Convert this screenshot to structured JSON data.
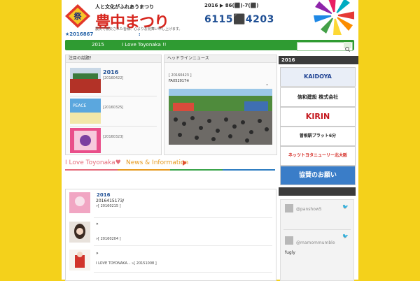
{
  "header": {
    "logo_subtitle": "人と文化がふれあうまつり",
    "logo_title": "豊中まつり",
    "logo_caption": "震災で被災された皆様、心よりお見舞い申し上げます。",
    "dates_line": "2016 ▶ 86(⬛)-7(⬛)",
    "dates_big": "6115⬛4203"
  },
  "notice": {
    "date_text": "★2016867",
    "colon": ":"
  },
  "nav": {
    "year": "2015",
    "love": "I Love Toyonaka !!",
    "search_placeholder": ""
  },
  "topics": {
    "head": "注目の話題！",
    "items": [
      {
        "year": "2016",
        "date": "[20160422]"
      },
      {
        "year": "",
        "date": "[20160325]"
      },
      {
        "year": "",
        "date": "[20160323]"
      }
    ]
  },
  "headline": {
    "head": "ヘッドラインニュース",
    "date": "[ 20160423 ]",
    "fax": "FAX52017※",
    "dot": "•"
  },
  "banner": {
    "love": "I Love Toyonaka♥",
    "news": "News & Information"
  },
  "posts": [
    {
      "year": "2016",
      "text": "2016415173/",
      "date": "»[ 20160215 ]"
    },
    {
      "year": "",
      "text": "»",
      "date": "»[ 20160204 ]"
    },
    {
      "year": "",
      "text": "»",
      "date": "I LOVE TOYONAKA... »[ 20151008 ]"
    }
  ],
  "sidebar": {
    "head": "2016",
    "ads": [
      {
        "label": "KAIDOYA",
        "color": "#1b3f91",
        "bg": "#e9eef7"
      },
      {
        "label": "信和建設 株式会社",
        "color": "#202020",
        "bg": "#ffffff"
      },
      {
        "label": "KIRIN",
        "color": "#c4161c",
        "bg": "#ffffff"
      },
      {
        "label": "曽根駅プラット6分",
        "color": "#222222",
        "bg": "#ffffff"
      },
      {
        "label": "ネッツトヨタニューリー北大阪",
        "color": "#d2231c",
        "bg": "#ffffff"
      },
      {
        "label": "協賛のお願い",
        "color": "#ffffff",
        "bg": "#3a7dc8"
      }
    ],
    "tweets": [
      {
        "user": "@panshow5",
        "text": ""
      },
      {
        "user": "@mamommumble",
        "text": "fugly"
      }
    ]
  },
  "colors": {
    "background": "#f4d11b",
    "nav_green": "#2f9b32",
    "title_red": "#d7261e",
    "link_blue": "#1f4f94"
  }
}
